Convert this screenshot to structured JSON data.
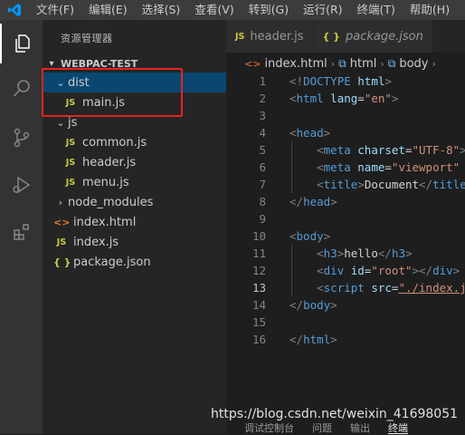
{
  "menubar": {
    "items": [
      "文件(F)",
      "编辑(E)",
      "选择(S)",
      "查看(V)",
      "转到(G)",
      "运行(R)",
      "终端(T)",
      "帮助(H)"
    ]
  },
  "colors": {
    "accent_logo": "#0098ff",
    "selection": "#094771",
    "highlight_box": "#e62222"
  },
  "explorer": {
    "title": "资源管理器",
    "project": "WEBPAC-TEST",
    "tree": [
      {
        "label": "dist",
        "type": "folder",
        "expanded": true,
        "selected": true,
        "icon": "chevron-down-icon"
      },
      {
        "label": "main.js",
        "type": "js"
      },
      {
        "label": "js",
        "type": "folder",
        "expanded": true,
        "icon": "chevron-down-icon"
      },
      {
        "label": "common.js",
        "type": "js"
      },
      {
        "label": "header.js",
        "type": "js"
      },
      {
        "label": "menu.js",
        "type": "js"
      },
      {
        "label": "node_modules",
        "type": "folder",
        "expanded": false,
        "icon": "chevron-right-icon"
      },
      {
        "label": "index.html",
        "type": "html"
      },
      {
        "label": "index.js",
        "type": "js"
      },
      {
        "label": "package.json",
        "type": "json"
      }
    ],
    "file_icons": {
      "js": "JS",
      "html": "<>",
      "json": "{ }"
    }
  },
  "tabs": [
    {
      "label": "header.js",
      "icon": "JS"
    },
    {
      "label": "package.json",
      "icon": "{ }"
    }
  ],
  "breadcrumb": {
    "file": "index.html",
    "file_icon": "<>",
    "parts": [
      "html",
      "body"
    ]
  },
  "editor": {
    "line_numbers": [
      "1",
      "2",
      "3",
      "4",
      "5",
      "6",
      "7",
      "8",
      "9",
      "10",
      "11",
      "12",
      "13",
      "14",
      "15",
      "16"
    ],
    "current_line": 13
  },
  "panel": {
    "tabs": [
      "调试控制台",
      "问题",
      "输出",
      "终端"
    ],
    "active": "终端"
  },
  "watermark": "https://blog.csdn.net/weixin_41698051"
}
